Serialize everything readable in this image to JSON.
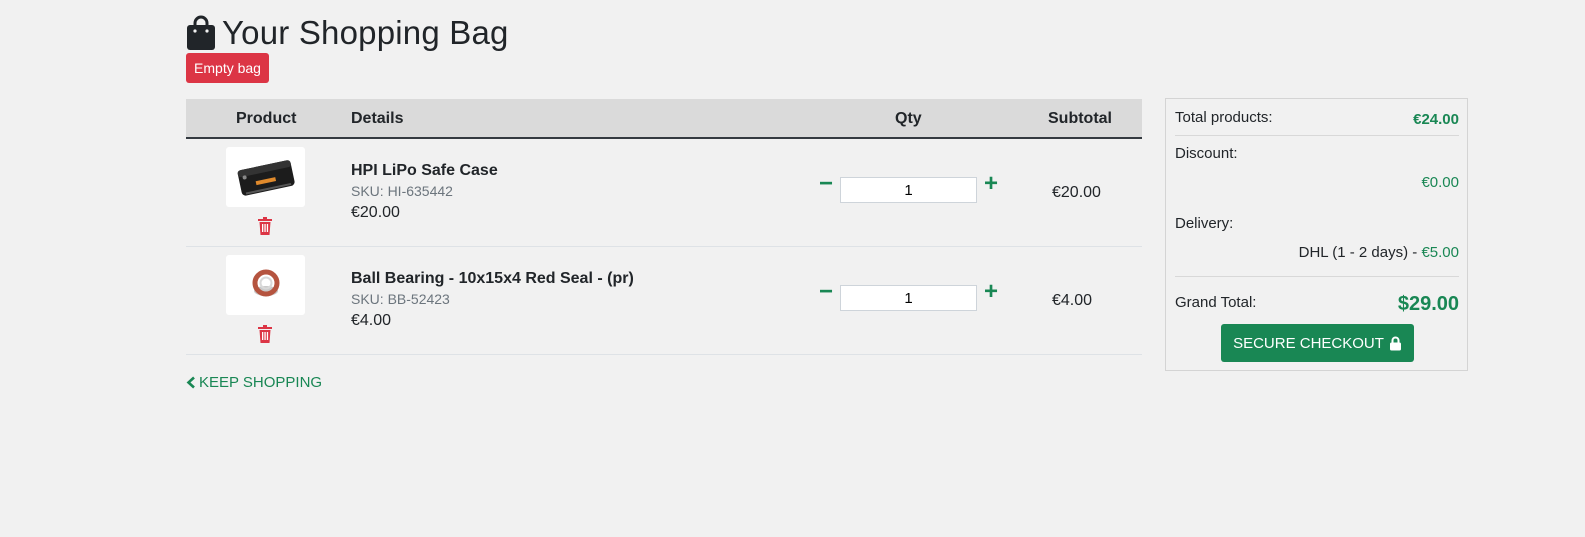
{
  "header": {
    "title": "Your Shopping Bag",
    "empty_button": "Empty bag",
    "icon": "shopping-bag-icon"
  },
  "table": {
    "headers": {
      "product": "Product",
      "details": "Details",
      "qty": "Qty",
      "subtotal": "Subtotal"
    },
    "items": [
      {
        "name": "HPI LiPo Safe Case",
        "sku": "SKU: HI-635442",
        "price": "€20.00",
        "qty": "1",
        "subtotal": "€20.00"
      },
      {
        "name": "Ball Bearing - 10x15x4 Red Seal - (pr)",
        "sku": "SKU: BB-52423",
        "price": "€4.00",
        "qty": "1",
        "subtotal": "€4.00"
      }
    ]
  },
  "keep_shopping": "KEEP SHOPPING",
  "summary": {
    "total_label": "Total products:",
    "total_value": "€24.00",
    "discount_label": "Discount:",
    "discount_value": "€0.00",
    "delivery_label": "Delivery:",
    "delivery_method": "DHL (1 - 2 days) - ",
    "delivery_value": "€5.00",
    "grand_label": "Grand Total:",
    "grand_value": "$29.00",
    "checkout_button": "SECURE CHECKOUT"
  },
  "colors": {
    "accent": "#198754",
    "danger": "#dc3545",
    "header_bg": "#dadada",
    "page_bg": "#f1f1f1"
  }
}
